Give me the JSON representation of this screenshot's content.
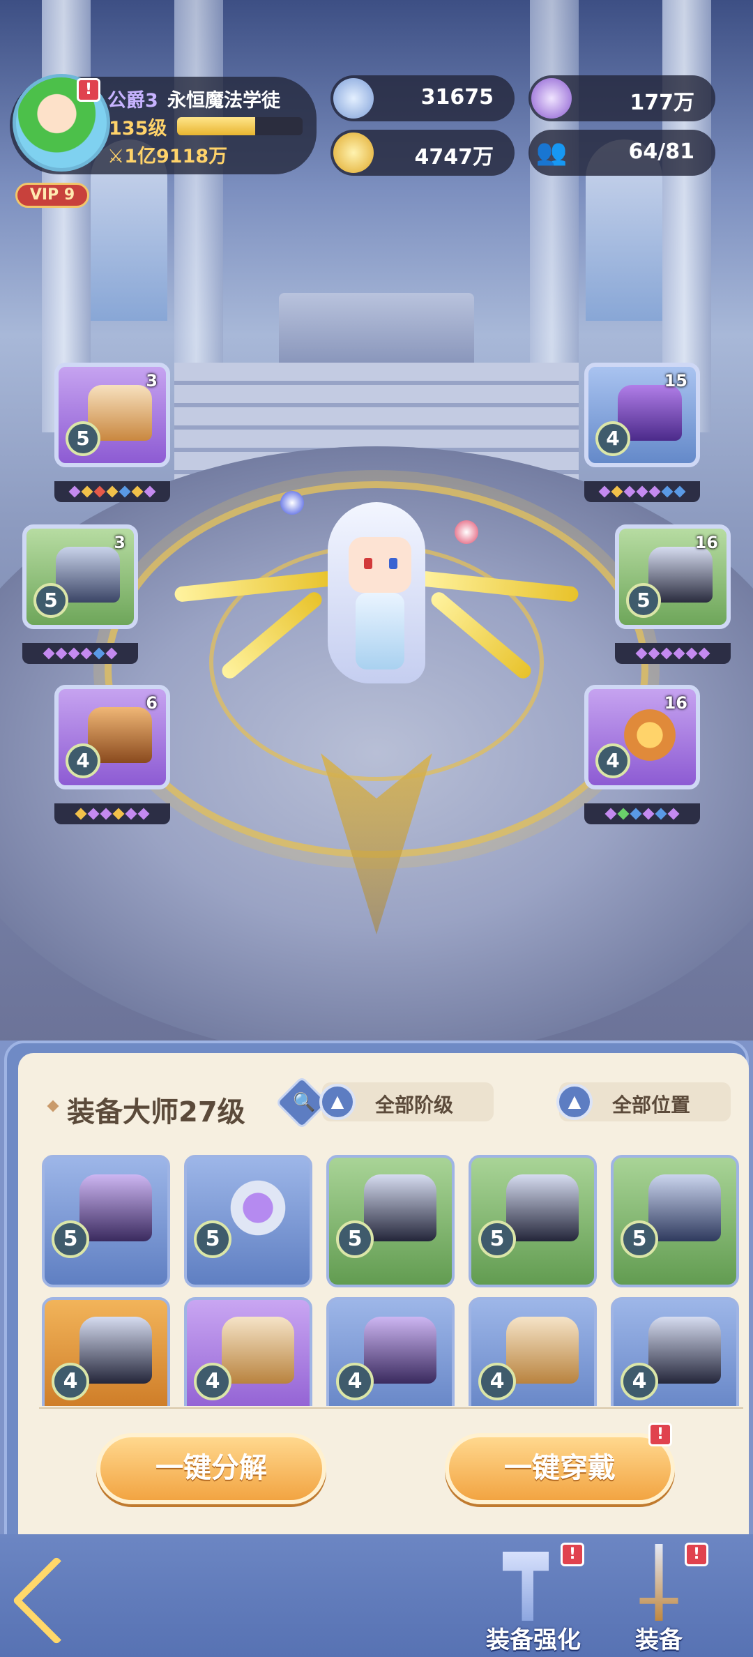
{
  "player": {
    "rank": "公爵3",
    "title": "永恒魔法学徒",
    "level": "135级",
    "level_progress": 0.62,
    "power": "1亿9118万",
    "vip": "VIP 9"
  },
  "resources": {
    "gems": "31675",
    "coins": "4747万",
    "purple_currency": "177万",
    "members": "64/81"
  },
  "equipped": [
    {
      "slot": "helmet",
      "count": "3",
      "level": "5",
      "color": "purple"
    },
    {
      "slot": "armor",
      "count": "3",
      "level": "5",
      "color": "green"
    },
    {
      "slot": "boots",
      "count": "6",
      "level": "4",
      "color": "purple"
    },
    {
      "slot": "hat",
      "count": "15",
      "level": "4",
      "color": "blue"
    },
    {
      "slot": "pants",
      "count": "16",
      "level": "5",
      "color": "green"
    },
    {
      "slot": "ring",
      "count": "16",
      "level": "4",
      "color": "purple"
    }
  ],
  "panel": {
    "title": "装备大师27级",
    "filter_tier": "全部阶级",
    "filter_position": "全部位置",
    "items": [
      {
        "level": "5",
        "color": "blue",
        "type": "boots-icon"
      },
      {
        "level": "5",
        "color": "blue",
        "type": "ring-icon"
      },
      {
        "level": "5",
        "color": "green",
        "type": "pants-icon"
      },
      {
        "level": "5",
        "color": "green",
        "type": "pants-icon"
      },
      {
        "level": "5",
        "color": "green",
        "type": "armor-icon"
      },
      {
        "level": "4",
        "color": "orange",
        "type": "pants-icon"
      },
      {
        "level": "4",
        "color": "purple",
        "type": "helmet-icon"
      },
      {
        "level": "4",
        "color": "blue",
        "type": "boots-icon"
      },
      {
        "level": "4",
        "color": "blue",
        "type": "helmet-icon"
      },
      {
        "level": "4",
        "color": "blue",
        "type": "pants-icon"
      }
    ],
    "btn_decompose": "一键分解",
    "btn_equip": "一键穿戴"
  },
  "nav": {
    "enhance": "装备强化",
    "equipment": "装备"
  },
  "alert_mark": "!"
}
